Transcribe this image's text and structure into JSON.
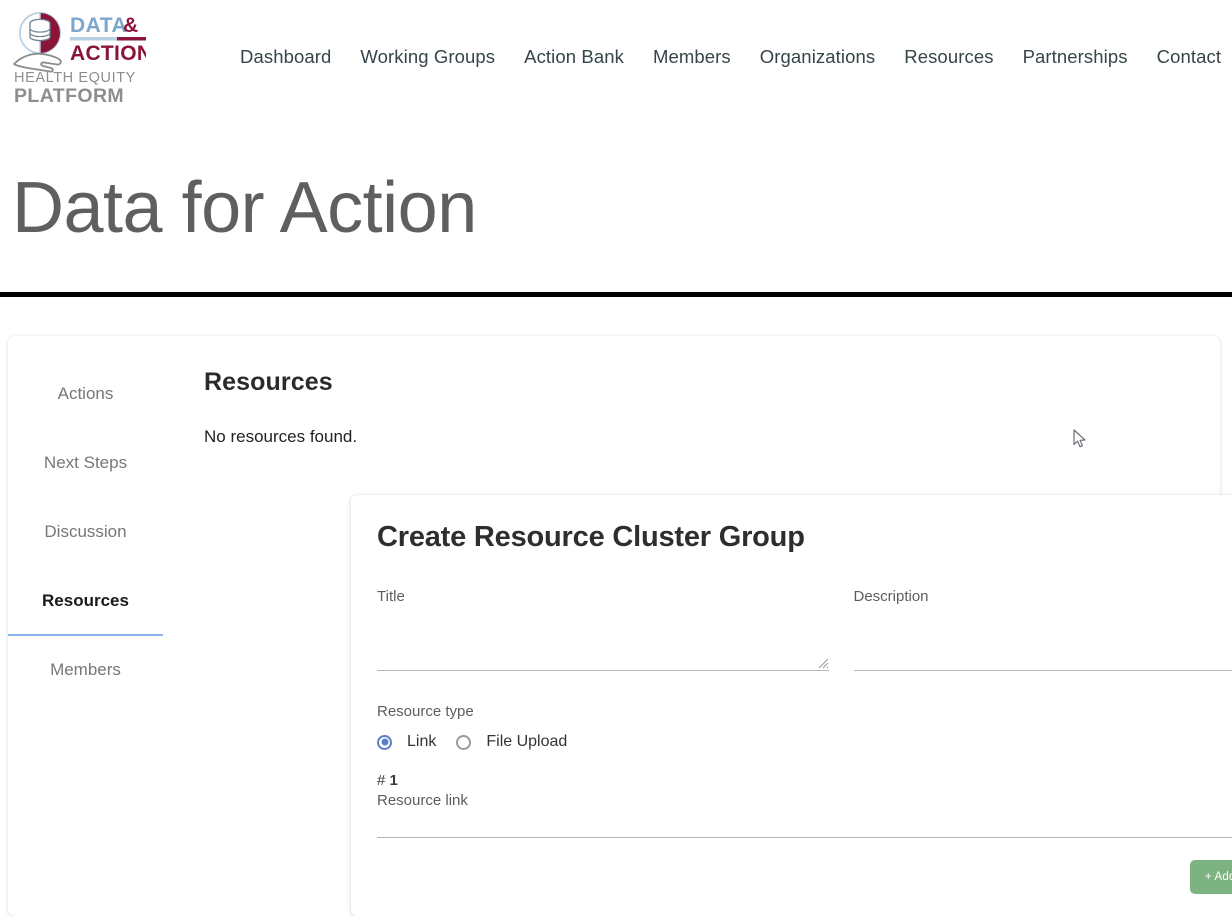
{
  "brand": {
    "logo_icon": "data-hand-circle-logo",
    "line1_part1": "DATA",
    "line1_part2": "&",
    "line2": "ACTION",
    "line3": "HEALTH EQUITY",
    "line4": "PLATFORM",
    "color_blue": "#7ba7cc",
    "color_maroon": "#8b1538",
    "color_gray": "#808080"
  },
  "nav": {
    "items": [
      {
        "label": "Dashboard"
      },
      {
        "label": "Working Groups"
      },
      {
        "label": "Action Bank"
      },
      {
        "label": "Members"
      },
      {
        "label": "Organizations"
      },
      {
        "label": "Resources"
      },
      {
        "label": "Partnerships"
      },
      {
        "label": "Contact"
      }
    ]
  },
  "page": {
    "title": "Data for Action"
  },
  "tabs": {
    "items": [
      {
        "label": "Actions",
        "active": false
      },
      {
        "label": "Next Steps",
        "active": false
      },
      {
        "label": "Discussion",
        "active": false
      },
      {
        "label": "Resources",
        "active": true
      },
      {
        "label": "Members",
        "active": false
      }
    ],
    "active_underline_color": "#8ab0e8"
  },
  "panel": {
    "heading": "Resources",
    "empty_message": "No resources found."
  },
  "form": {
    "heading": "Create Resource Cluster Group",
    "title_field": {
      "label": "Title",
      "value": "",
      "placeholder": ""
    },
    "description_field": {
      "label": "Description",
      "value": "",
      "placeholder": ""
    },
    "resource_type": {
      "label": "Resource type",
      "options": [
        {
          "label": "Link",
          "selected": true
        },
        {
          "label": "File Upload",
          "selected": false
        }
      ],
      "selected_color": "#5b7fc7"
    },
    "entries": [
      {
        "index_label": "#",
        "index_number": "1",
        "link_label": "Resource link",
        "link_value": "",
        "link_placeholder": ""
      }
    ],
    "add_more_button": {
      "label": "+ Add More",
      "color": "#7db380"
    }
  }
}
